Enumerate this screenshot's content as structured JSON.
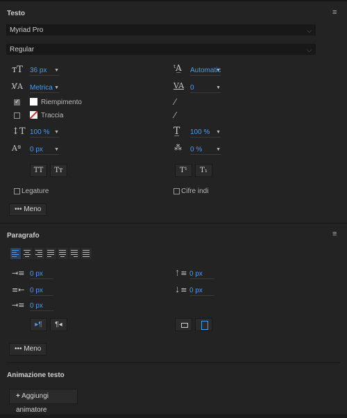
{
  "text_section": {
    "title": "Testo",
    "font_family": "Myriad Pro",
    "font_style": "Regular",
    "font_size": "36 px",
    "leading": "Automatic",
    "kerning": "Metrica",
    "tracking": "0",
    "fill_label": "Riempimento",
    "fill_checked": true,
    "stroke_label": "Traccia",
    "stroke_checked": false,
    "vertical_scale": "100 %",
    "horizontal_scale": "100 %",
    "baseline_shift": "0 px",
    "tsume": "0 %",
    "allcaps_label": "TT",
    "smallcaps_label": "Tт",
    "superscript_label": "T¹",
    "subscript_label": "T₁",
    "ligatures_label": "Legature",
    "indic_digits_label": "Cifre indi",
    "more_label": "Meno"
  },
  "paragraph_section": {
    "title": "Paragrafo",
    "indent_left": "0 px",
    "indent_right": "0 px",
    "indent_first": "0 px",
    "space_before": "0 px",
    "space_after": "0 px",
    "more_label": "Meno"
  },
  "animation_section": {
    "title": "Animazione testo",
    "add_animator_label": "Aggiungi animatore"
  },
  "colors": {
    "panel_bg": "#232323",
    "field_bg": "#181818",
    "accent_blue": "#4a9cf0",
    "stroke_red": "#d03030"
  }
}
